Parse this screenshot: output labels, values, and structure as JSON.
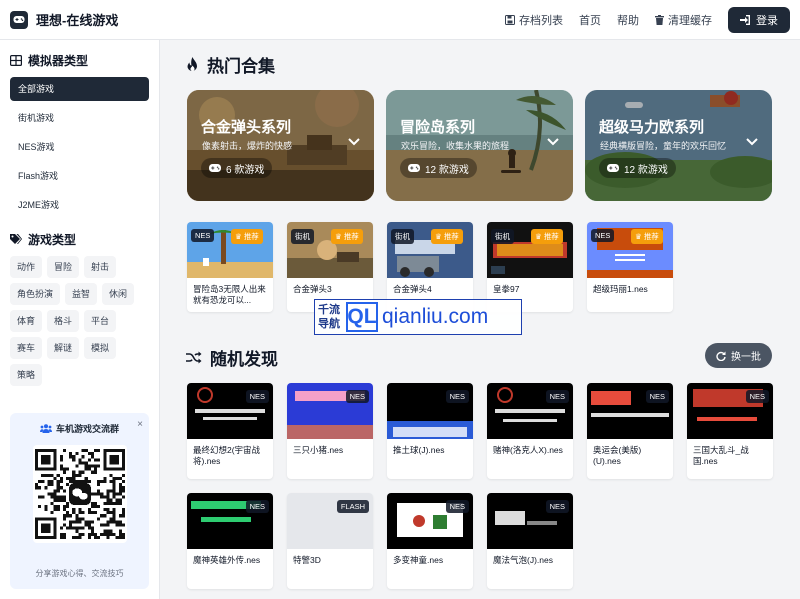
{
  "header": {
    "title": "理想-在线游戏",
    "nav": {
      "saves": "存档列表",
      "home": "首页",
      "help": "帮助",
      "clear_cache": "清理缓存"
    },
    "login": "登录"
  },
  "sidebar": {
    "emulator_heading": "模拟器类型",
    "emulators": [
      "全部游戏",
      "街机游戏",
      "NES游戏",
      "Flash游戏",
      "J2ME游戏"
    ],
    "genre_heading": "游戏类型",
    "genres": [
      "动作",
      "冒险",
      "射击",
      "角色扮演",
      "益智",
      "休闲",
      "体育",
      "格斗",
      "平台",
      "赛车",
      "解谜",
      "模拟",
      "策略"
    ],
    "qr": {
      "title": "车机游戏交流群",
      "close": "×",
      "subtitle": "分享游戏心得、交流技巧"
    }
  },
  "hot": {
    "heading": "热门合集",
    "collections": [
      {
        "title": "合金弹头系列",
        "subtitle": "像素射击，爆炸的快感",
        "count": "6 款游戏"
      },
      {
        "title": "冒险岛系列",
        "subtitle": "欢乐冒险，收集水果的旅程",
        "count": "12 款游戏"
      },
      {
        "title": "超级马力欧系列",
        "subtitle": "经典横版冒险，童年的欢乐回忆",
        "count": "12 款游戏"
      }
    ],
    "games": [
      {
        "name": "冒险岛3无限人出来就有恐龙可以...",
        "system": "NES",
        "hot": "推荐"
      },
      {
        "name": "合金弹头3",
        "system": "街机",
        "hot": "推荐"
      },
      {
        "name": "合金弹头4",
        "system": "街机",
        "hot": "推荐"
      },
      {
        "name": "皇拳97",
        "system": "街机",
        "hot": "推荐"
      },
      {
        "name": "超级玛丽1.nes",
        "system": "NES",
        "hot": "推荐"
      }
    ]
  },
  "random": {
    "heading": "随机发现",
    "refresh": "换一批",
    "games": [
      {
        "name": "最终幻想2(宇宙战将).nes",
        "system": "NES"
      },
      {
        "name": "三只小猪.nes",
        "system": "NES"
      },
      {
        "name": "推土球(J).nes",
        "system": "NES"
      },
      {
        "name": "赌神(洛克人X).nes",
        "system": "NES"
      },
      {
        "name": "奥运会(美版)(U).nes",
        "system": "NES"
      },
      {
        "name": "三国大乱斗_战国.nes",
        "system": "NES"
      },
      {
        "name": "魔神英雄外传.nes",
        "system": "NES"
      },
      {
        "name": "特警3D",
        "system": "FLASH"
      },
      {
        "name": "多变神童.nes",
        "system": "NES"
      },
      {
        "name": "魔法气泡(J).nes",
        "system": "NES"
      }
    ]
  },
  "watermark": {
    "cn": "千流导航",
    "ql": "QL",
    "domain": "qianliu.com"
  }
}
